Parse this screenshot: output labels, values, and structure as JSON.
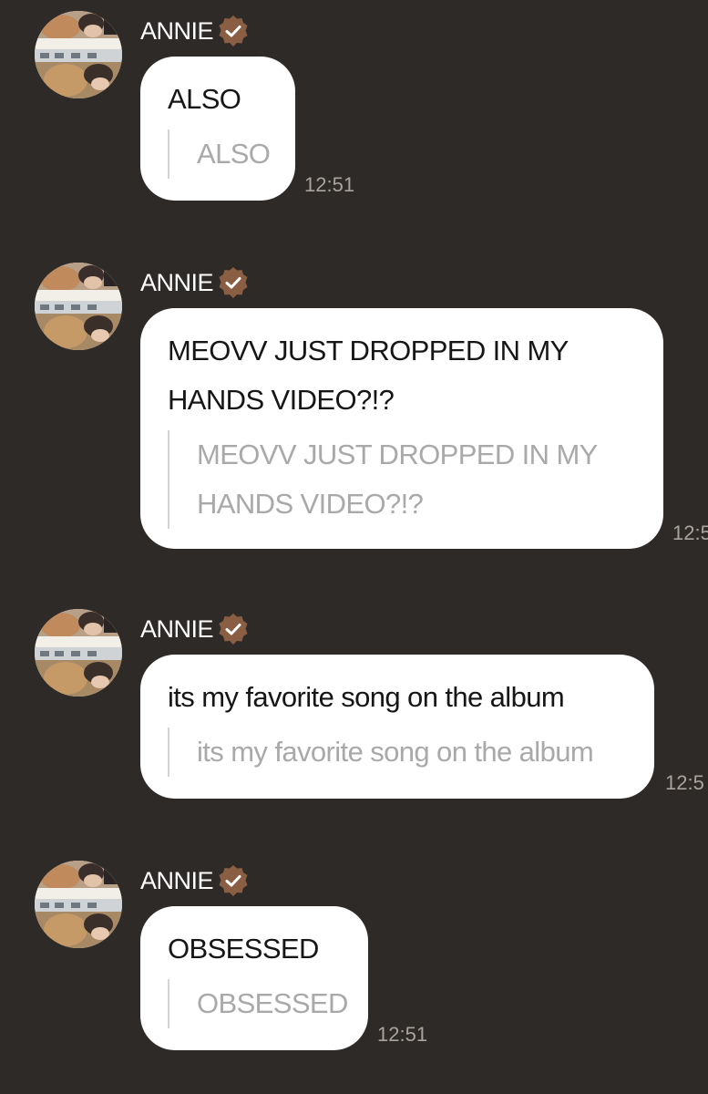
{
  "messages": [
    {
      "sender": "ANNIE",
      "verified_icon": "verified-badge-icon",
      "text": "ALSO",
      "quoted": "ALSO",
      "time": "12:51"
    },
    {
      "sender": "ANNIE",
      "verified_icon": "verified-badge-icon",
      "text": "MEOVV JUST DROPPED IN MY HANDS VIDEO?!?",
      "quoted": "MEOVV JUST DROPPED IN MY HANDS VIDEO?!?",
      "time": "12:5"
    },
    {
      "sender": "ANNIE",
      "verified_icon": "verified-badge-icon",
      "text": "its my favorite song on the album",
      "quoted": "its my favorite song on the album",
      "time": "12:5"
    },
    {
      "sender": "ANNIE",
      "verified_icon": "verified-badge-icon",
      "text": "OBSESSED",
      "quoted": "OBSESSED",
      "time": "12:51"
    }
  ],
  "colors": {
    "background": "#2e2a27",
    "bubble": "#ffffff",
    "badge": "#8a5e43",
    "quote_text": "#a9a9a9",
    "timestamp": "#a8a39d"
  }
}
